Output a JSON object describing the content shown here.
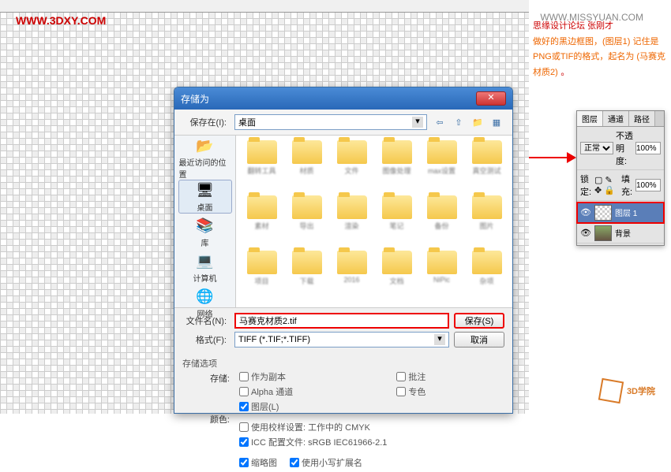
{
  "watermark": "WWW.3DXY.COM",
  "watermark2": "WWW.MISSYUAN.COM",
  "note": {
    "line1": "思缘设计论坛 张刚才",
    "line2": "做好的黑边框图，(图层1) 记住是PNG或TIF的格式，起名为 (马赛克材质2)",
    "dot": "。"
  },
  "dialog": {
    "title": "存储为",
    "close": "✕",
    "savein_label": "保存在(I):",
    "savein_value": "桌面",
    "places": [
      {
        "label": "最近访问的位置",
        "icon": "📁"
      },
      {
        "label": "桌面",
        "icon": "🖥"
      },
      {
        "label": "库",
        "icon": "📚"
      },
      {
        "label": "计算机",
        "icon": "💻"
      },
      {
        "label": "网络",
        "icon": "🌐"
      }
    ],
    "filename_label": "文件名(N):",
    "filename_value": "马赛克材质2.tif",
    "format_label": "格式(F):",
    "format_value": "TIFF (*.TIF;*.TIFF)",
    "save_btn": "保存(S)",
    "cancel_btn": "取消",
    "options_title": "存储选项",
    "save_label": "存储:",
    "chk_copy": "作为副本",
    "chk_notes": "批注",
    "chk_alpha": "Alpha 通道",
    "chk_spot": "专色",
    "chk_layers": "图层(L)",
    "color_label": "颜色:",
    "chk_proof": "使用校样设置: 工作中的 CMYK",
    "chk_icc": "ICC 配置文件: sRGB IEC61966-2.1",
    "chk_thumb": "缩略图",
    "chk_lower": "使用小写扩展名"
  },
  "panel": {
    "tab1": "图层",
    "tab2": "通道",
    "tab3": "路径",
    "mode": "正常",
    "opacity_label": "不透明度:",
    "opacity_value": "100%",
    "lock_label": "锁定:",
    "fill_label": "填充:",
    "fill_value": "100%",
    "layer1": "图层 1",
    "layer_bg": "背景"
  },
  "logo": "3D学院"
}
